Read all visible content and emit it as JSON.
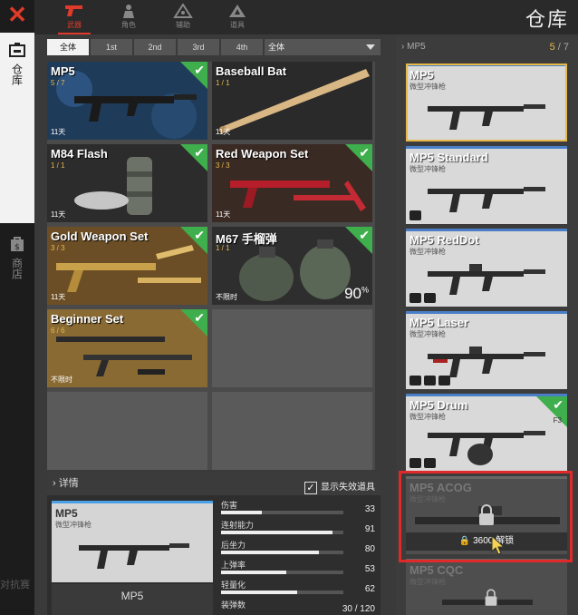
{
  "app": {
    "close_icon": "close-icon",
    "page_title": "仓库",
    "rail": [
      {
        "label": "仓库",
        "icon": "warehouse-icon",
        "active": true
      },
      {
        "label": "商店",
        "icon": "shop-icon",
        "active": false
      }
    ],
    "rail_bg_text": "对抗赛"
  },
  "categories": [
    {
      "label": "武器",
      "icon": "pistol-icon",
      "active": true
    },
    {
      "label": "角色",
      "icon": "character-icon",
      "active": false
    },
    {
      "label": "辅助",
      "icon": "support-icon",
      "active": false
    },
    {
      "label": "道具",
      "icon": "item-icon",
      "active": false
    }
  ],
  "filters": {
    "buttons": [
      "全体",
      "1st",
      "2nd",
      "3rd",
      "4th"
    ],
    "active": "全体",
    "dropdown_value": "全体"
  },
  "inventory": [
    {
      "name": "MP5",
      "count": "5 / 7",
      "time": "11天",
      "owned": true,
      "selected": true
    },
    {
      "name": "Baseball Bat",
      "count": "1 / 1",
      "time": "11天",
      "owned": false
    },
    {
      "name": "M84 Flash",
      "count": "1 / 1",
      "time": "11天",
      "owned": true
    },
    {
      "name": "Red Weapon Set",
      "count": "3 / 3",
      "time": "11天",
      "owned": true
    },
    {
      "name": "Gold Weapon Set",
      "count": "3 / 3",
      "time": "11天",
      "owned": true
    },
    {
      "name": "M67 手榴弹",
      "count": "1 / 1",
      "time": "不限时",
      "percent": "90",
      "percent_sign": "%",
      "owned": true
    },
    {
      "name": "Beginner Set",
      "count": "6 / 6",
      "time": "不限时",
      "owned": true
    }
  ],
  "details": {
    "header": "详情",
    "toggle_label": "显示失效道具",
    "toggle_checked": true,
    "thumb_name": "MP5",
    "thumb_sub": "微型冲锋枪",
    "name": "MP5",
    "stats": [
      {
        "label": "伤害",
        "value": "33",
        "fill": 0.33
      },
      {
        "label": "连射能力",
        "value": "91",
        "fill": 0.91
      },
      {
        "label": "后坐力",
        "value": "80",
        "fill": 0.8
      },
      {
        "label": "上弹率",
        "value": "53",
        "fill": 0.53
      },
      {
        "label": "轻量化",
        "value": "62",
        "fill": 0.62
      },
      {
        "label": "装弹数",
        "value": "30 / 120"
      }
    ]
  },
  "variants_panel": {
    "header": "MP5",
    "owned": "5",
    "total": "7",
    "items": [
      {
        "name": "MP5",
        "sub": "微型冲锋枪",
        "selected": true,
        "attachments": []
      },
      {
        "name": "MP5 Standard",
        "sub": "微型冲锋枪",
        "attachments": [
          "sight-icon"
        ]
      },
      {
        "name": "MP5 RedDot",
        "sub": "微型冲锋枪",
        "attachments": [
          "sight-icon",
          "grip-icon"
        ]
      },
      {
        "name": "MP5 Laser",
        "sub": "微型冲锋枪",
        "attachments": [
          "sight-icon",
          "laser-icon",
          "grip-icon"
        ]
      },
      {
        "name": "MP5 Drum",
        "sub": "微型冲锋枪",
        "badge": "F3",
        "owned": true,
        "attachments": [
          "knife-icon",
          "drum-icon"
        ]
      },
      {
        "name": "MP5 ACOG",
        "sub": "微型冲锋枪",
        "locked": true,
        "unlock_label": "解锁",
        "unlock_cost": "3600"
      },
      {
        "name": "MP5 CQC",
        "sub": "微型冲锋枪",
        "locked": true
      }
    ]
  },
  "colors": {
    "accent_red": "#e03a2a",
    "owned_green": "#3fae4c",
    "gold": "#e6b94a"
  }
}
